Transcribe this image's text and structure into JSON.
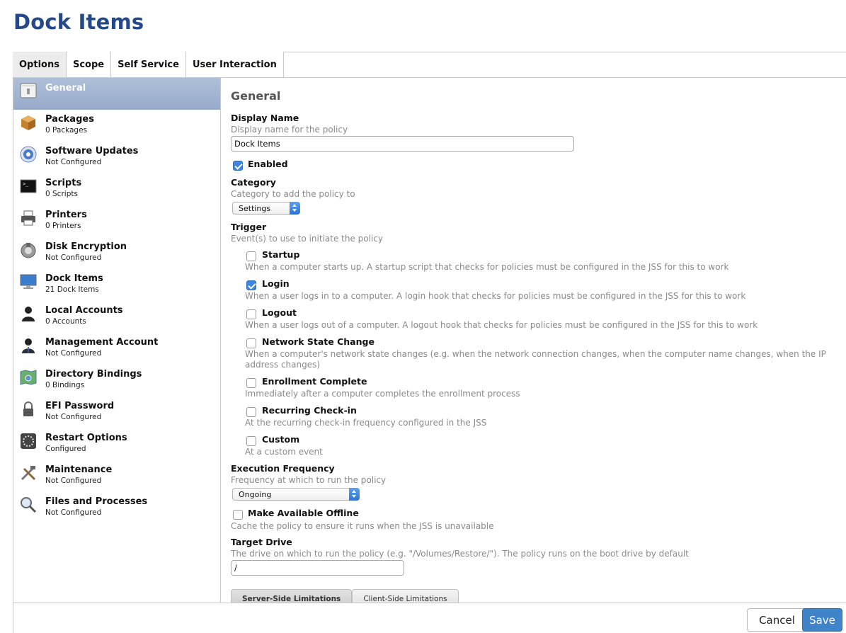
{
  "page_title": "Dock Items",
  "tabs": [
    {
      "label": "Options",
      "active": true
    },
    {
      "label": "Scope",
      "active": false
    },
    {
      "label": "Self Service",
      "active": false
    },
    {
      "label": "User Interaction",
      "active": false
    }
  ],
  "sidebar": {
    "items": [
      {
        "label": "General",
        "sub": "",
        "icon": "general-icon",
        "selected": true
      },
      {
        "label": "Packages",
        "sub": "0 Packages",
        "icon": "package-icon"
      },
      {
        "label": "Software Updates",
        "sub": "Not Configured",
        "icon": "software-update-icon"
      },
      {
        "label": "Scripts",
        "sub": "0 Scripts",
        "icon": "terminal-icon"
      },
      {
        "label": "Printers",
        "sub": "0 Printers",
        "icon": "printer-icon"
      },
      {
        "label": "Disk Encryption",
        "sub": "Not Configured",
        "icon": "disk-encryption-icon"
      },
      {
        "label": "Dock Items",
        "sub": "21 Dock Items",
        "icon": "monitor-icon"
      },
      {
        "label": "Local Accounts",
        "sub": "0 Accounts",
        "icon": "user-icon"
      },
      {
        "label": "Management Account",
        "sub": "Not Configured",
        "icon": "manager-icon"
      },
      {
        "label": "Directory Bindings",
        "sub": "0 Bindings",
        "icon": "directory-icon"
      },
      {
        "label": "EFI Password",
        "sub": "Not Configured",
        "icon": "lock-icon"
      },
      {
        "label": "Restart Options",
        "sub": "Configured",
        "icon": "restart-icon"
      },
      {
        "label": "Maintenance",
        "sub": "Not Configured",
        "icon": "tools-icon"
      },
      {
        "label": "Files and Processes",
        "sub": "Not Configured",
        "icon": "magnifier-icon"
      }
    ]
  },
  "general": {
    "section_title": "General",
    "display_name": {
      "label": "Display Name",
      "desc": "Display name for the policy",
      "value": "Dock Items"
    },
    "enabled": {
      "label": "Enabled",
      "checked": true
    },
    "category": {
      "label": "Category",
      "desc": "Category to add the policy to",
      "value": "Settings"
    },
    "trigger": {
      "label": "Trigger",
      "desc": "Event(s) to use to initiate the policy",
      "options": [
        {
          "label": "Startup",
          "checked": false,
          "desc": "When a computer starts up. A startup script that checks for policies must be configured in the JSS for this to work"
        },
        {
          "label": "Login",
          "checked": true,
          "desc": "When a user logs in to a computer. A login hook that checks for policies must be configured in the JSS for this to work"
        },
        {
          "label": "Logout",
          "checked": false,
          "desc": "When a user logs out of a computer. A logout hook that checks for policies must be configured in the JSS for this to work"
        },
        {
          "label": "Network State Change",
          "checked": false,
          "desc": "When a computer's network state changes (e.g. when the network connection changes, when the computer name changes, when the IP address changes)"
        },
        {
          "label": "Enrollment Complete",
          "checked": false,
          "desc": "Immediately after a computer completes the enrollment process"
        },
        {
          "label": "Recurring Check-in",
          "checked": false,
          "desc": "At the recurring check-in frequency configured in the JSS"
        },
        {
          "label": "Custom",
          "checked": false,
          "desc": "At a custom event"
        }
      ]
    },
    "execution_frequency": {
      "label": "Execution Frequency",
      "desc": "Frequency at which to run the policy",
      "value": "Ongoing"
    },
    "offline": {
      "label": "Make Available Offline",
      "checked": false,
      "desc": "Cache the policy to ensure it runs when the JSS is unavailable"
    },
    "target_drive": {
      "label": "Target Drive",
      "desc": "The drive on which to run the policy (e.g. \"/Volumes/Restore/\"). The policy runs on the boot drive by default",
      "value": "/"
    }
  },
  "limitation_tabs": [
    {
      "label": "Server-Side Limitations",
      "active": true
    },
    {
      "label": "Client-Side Limitations",
      "active": false
    }
  ],
  "footer": {
    "cancel_label": "Cancel",
    "save_label": "Save"
  },
  "colors": {
    "title": "#24488a",
    "selected_bg": "#a3b5d2",
    "accent": "#3f83c8"
  }
}
